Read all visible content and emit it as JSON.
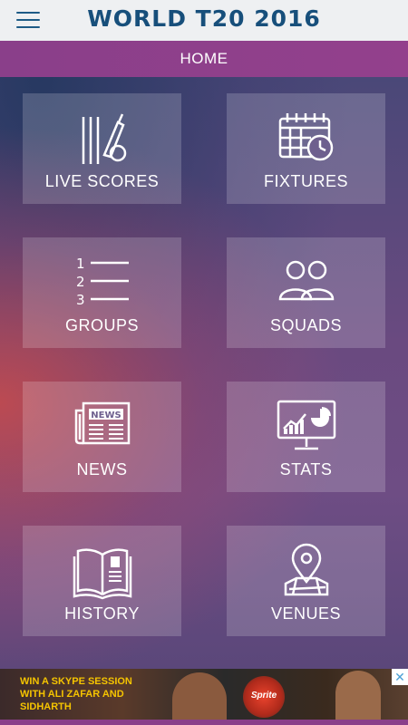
{
  "app": {
    "title": "WORLD T20 2016",
    "section": "HOME"
  },
  "tiles": [
    {
      "label": "LIVE SCORES",
      "icon": "cricket-bat-ball-icon"
    },
    {
      "label": "FIXTURES",
      "icon": "calendar-clock-icon"
    },
    {
      "label": "GROUPS",
      "icon": "numbered-list-icon"
    },
    {
      "label": "SQUADS",
      "icon": "people-icon"
    },
    {
      "label": "NEWS",
      "icon": "newspaper-icon"
    },
    {
      "label": "STATS",
      "icon": "chart-monitor-icon"
    },
    {
      "label": "HISTORY",
      "icon": "book-icon"
    },
    {
      "label": "VENUES",
      "icon": "map-pin-icon"
    }
  ],
  "ad": {
    "text": "WIN A SKYPE SESSION WITH ALI ZAFAR AND SIDHARTH",
    "brand": "Sprite",
    "close": "✕"
  },
  "colors": {
    "appbar": "#eef0f2",
    "title": "#174f7b",
    "subbar": "#8a3f8a",
    "tile": "rgba(255,255,255,0.18)"
  }
}
